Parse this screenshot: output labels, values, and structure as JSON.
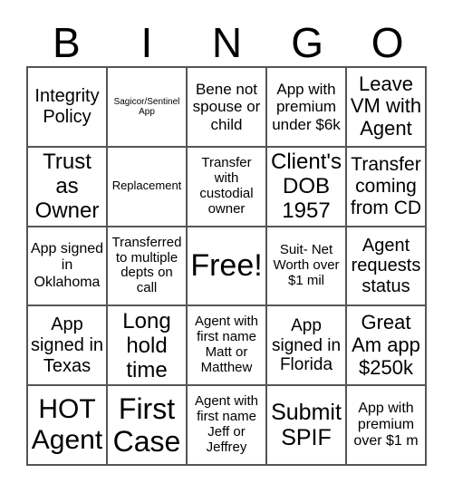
{
  "header": [
    "B",
    "I",
    "N",
    "G",
    "O"
  ],
  "cells": [
    "Integrity Policy",
    "Sagicor/Sentinel App",
    "Bene not spouse or child",
    "App with premium under $6k",
    "Leave VM with Agent",
    "Trust as Owner",
    "Replacement",
    "Transfer with custodial owner",
    "Client's DOB 1957",
    "Transfer coming from CD",
    "App signed in Oklahoma",
    "Transferred to multiple depts on call",
    "Free!",
    "Suit- Net Worth over $1 mil",
    "Agent requests status",
    "App signed in Texas",
    "Long hold time",
    "Agent with first name Matt or Matthew",
    "App signed in Florida",
    "Great Am app $250k",
    "HOT Agent",
    "First Case",
    "Agent with first name Jeff or Jeffrey",
    "Submit SPIF",
    "App with premium over $1 m"
  ]
}
